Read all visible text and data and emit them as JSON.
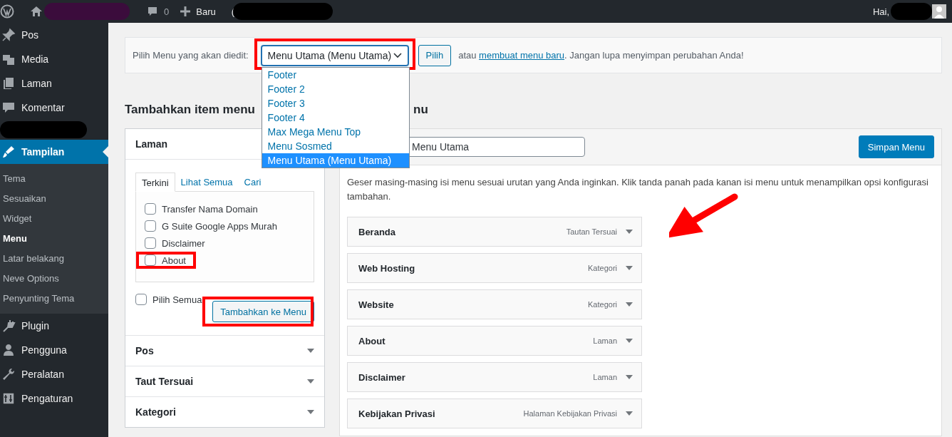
{
  "admin_bar": {
    "comments": "0",
    "new_label": "Baru",
    "fragment": "(",
    "greeting": "Hai,"
  },
  "sidebar": {
    "items": [
      {
        "kind": "link",
        "label": "Pos",
        "selected": false
      },
      {
        "kind": "link",
        "label": "Media",
        "selected": false
      },
      {
        "kind": "link",
        "label": "Laman",
        "selected": false
      },
      {
        "kind": "link",
        "label": "Komentar",
        "selected": false
      },
      {
        "kind": "redacted"
      },
      {
        "kind": "link",
        "label": "Tampilan",
        "selected": true,
        "children": [
          {
            "label": "Tema",
            "selected": false
          },
          {
            "label": "Sesuaikan",
            "selected": false
          },
          {
            "label": "Widget",
            "selected": false
          },
          {
            "label": "Menu",
            "selected": true
          },
          {
            "label": "Latar belakang",
            "selected": false
          },
          {
            "label": "Neve Options",
            "selected": false
          },
          {
            "label": "Penyunting Tema",
            "selected": false
          }
        ]
      },
      {
        "kind": "link",
        "label": "Plugin",
        "selected": false
      },
      {
        "kind": "link",
        "label": "Pengguna",
        "selected": false
      },
      {
        "kind": "link",
        "label": "Peralatan",
        "selected": false
      },
      {
        "kind": "link",
        "label": "Pengaturan",
        "selected": false
      }
    ]
  },
  "menu_picker": {
    "label": "Pilih Menu yang akan diedit:",
    "value": "Menu Utama (Menu Utama)",
    "highlighted": true,
    "expanded": true,
    "options": [
      {
        "label": "Footer",
        "selected": false
      },
      {
        "label": "Footer 2",
        "selected": false
      },
      {
        "label": "Footer 3",
        "selected": false
      },
      {
        "label": "Footer 4",
        "selected": false
      },
      {
        "label": "Max Mega Menu Top",
        "selected": false
      },
      {
        "label": "Menu Sosmed",
        "selected": false
      },
      {
        "label": "Menu Utama (Menu Utama)",
        "selected": true
      }
    ],
    "button": "Pilih",
    "hint_prefix": "atau",
    "hint_link": "membuat menu baru",
    "hint_suffix": ". Jangan lupa menyimpan perubahan Anda!"
  },
  "add_items": {
    "heading": "Tambahkan item menu",
    "panels": [
      {
        "title": "Laman",
        "expanded": true,
        "tabs": [
          {
            "label": "Terkini",
            "selected": true
          },
          {
            "label": "Lihat Semua",
            "selected": false
          },
          {
            "label": "Cari",
            "selected": false
          }
        ],
        "items": [
          {
            "label": "Transfer Nama Domain",
            "checked": false,
            "highlighted": false
          },
          {
            "label": "G Suite Google Apps Murah",
            "checked": false,
            "highlighted": false
          },
          {
            "label": "Disclaimer",
            "checked": false,
            "highlighted": false
          },
          {
            "label": "About",
            "checked": false,
            "highlighted": true
          }
        ],
        "select_all": {
          "label": "Pilih Semua",
          "checked": false
        },
        "add_button": {
          "label": "Tambahkan ke Menu",
          "highlighted": true
        }
      },
      {
        "title": "Pos",
        "expanded": false
      },
      {
        "title": "Taut Tersuai",
        "expanded": false
      },
      {
        "title": "Kategori",
        "expanded": false
      }
    ]
  },
  "structure": {
    "heading": "nu",
    "name_field": {
      "value": "Menu Utama"
    },
    "save_button": "Simpan Menu",
    "instructions": "Geser masing-masing isi menu sesuai urutan yang Anda inginkan. Klik tanda panah pada kanan isi menu untuk menampilkan opsi konfigurasi tambahan.",
    "items": [
      {
        "title": "Beranda",
        "type": "Tautan Tersuai"
      },
      {
        "title": "Web Hosting",
        "type": "Kategori"
      },
      {
        "title": "Website",
        "type": "Kategori"
      },
      {
        "title": "About",
        "type": "Laman"
      },
      {
        "title": "Disclaimer",
        "type": "Laman"
      },
      {
        "title": "Kebijakan Privasi",
        "type": "Halaman Kebijakan Privasi"
      }
    ]
  }
}
